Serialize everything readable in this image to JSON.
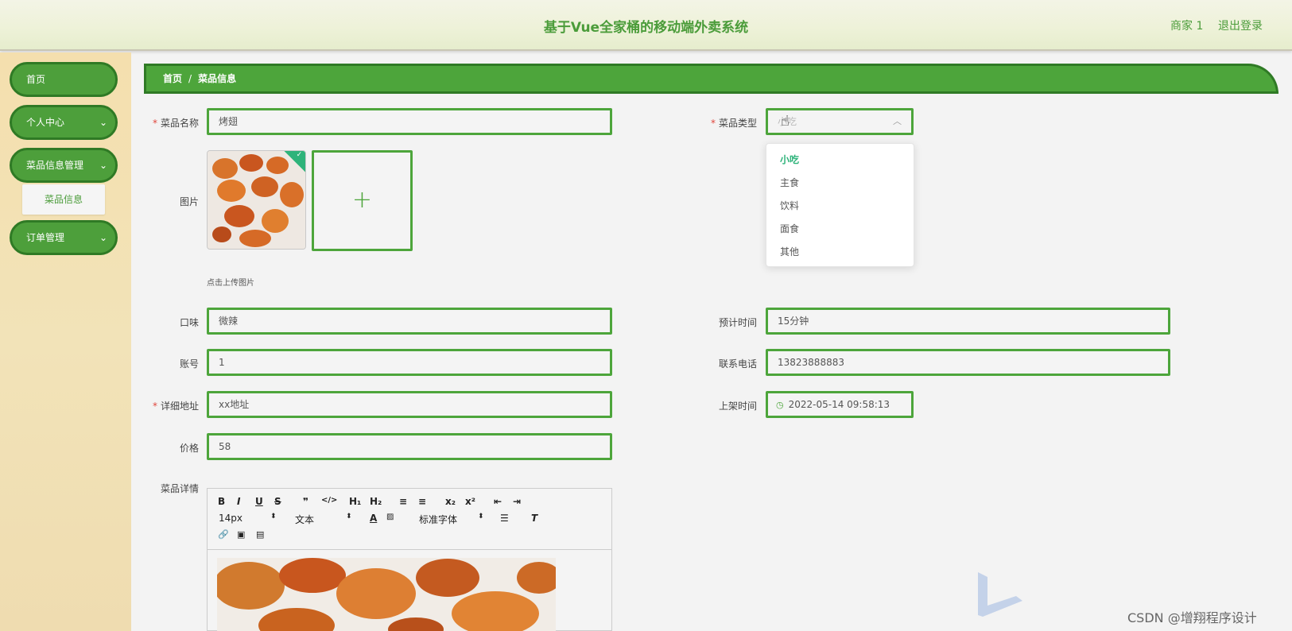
{
  "header": {
    "title": "基于Vue全家桶的移动端外卖系统",
    "user": "商家 1",
    "logout": "退出登录"
  },
  "sidebar": {
    "items": [
      {
        "label": "首页"
      },
      {
        "label": "个人中心"
      },
      {
        "label": "菜品信息管理"
      },
      {
        "label": "订单管理"
      }
    ],
    "sub_label": "菜品信息"
  },
  "breadcrumb": {
    "home": "首页",
    "separator": "/",
    "current": "菜品信息"
  },
  "form": {
    "name_label": "菜品名称",
    "name_value": "烤翅",
    "type_label": "菜品类型",
    "type_value": "小吃",
    "image_label": "图片",
    "upload_tip": "点击上传图片",
    "taste_label": "口味",
    "taste_value": "微辣",
    "time_label": "预计时间",
    "time_value": "15分钟",
    "account_label": "账号",
    "account_value": "1",
    "phone_label": "联系电话",
    "phone_value": "13823888883",
    "address_label": "详细地址",
    "address_value": "xx地址",
    "shelf_label": "上架时间",
    "shelf_value": "2022-05-14 09:58:13",
    "price_label": "价格",
    "price_value": "58",
    "detail_label": "菜品详情"
  },
  "dropdown": {
    "options": [
      "小吃",
      "主食",
      "饮料",
      "面食",
      "其他"
    ],
    "selected": "小吃"
  },
  "editor": {
    "font_size": "14px",
    "format": "文本",
    "font_family": "标准字体"
  },
  "watermark": "CSDN @增翔程序设计",
  "colors": {
    "primary": "#4da53b",
    "dark": "#2f7a25",
    "selected": "#2eb37a",
    "required": "#e0463c"
  }
}
